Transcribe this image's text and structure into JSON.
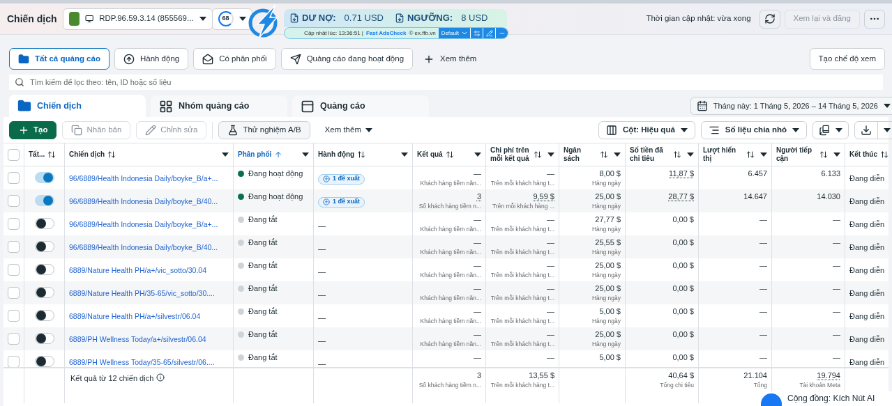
{
  "header": {
    "title": "Chiến dịch",
    "account": "RDP.96.59.3.14 (855569...",
    "score": "68",
    "update_time": "Thời gian cập nhật: vừa xong",
    "review_button": {
      "label": "Xem lại và đăng",
      "disabled": true
    }
  },
  "extension": {
    "debt_label": "DƯ NỢ:",
    "debt_value": "0.71 USD",
    "threshold_label": "NGƯỠNG:",
    "threshold_value": "8 USD",
    "updated": "Cập nhật lúc: 13:36:51 |",
    "brand": "Fast AdsCheck",
    "site": "© ex.ffb.vn",
    "preset": "Default"
  },
  "filters": [
    {
      "label": "Tất cả quảng cáo",
      "selected": true,
      "kind": "folder"
    },
    {
      "label": "Hành động",
      "selected": false,
      "kind": "action"
    },
    {
      "label": "Có phân phối",
      "selected": false,
      "kind": "mail"
    },
    {
      "label": "Quảng cáo đang hoạt động",
      "selected": false,
      "kind": "send"
    },
    {
      "label": "Xem thêm",
      "selected": false,
      "kind": "more"
    }
  ],
  "create_view": "Tạo chế độ xem",
  "search": {
    "placeholder": "Tìm kiếm để lọc theo: tên, ID hoặc số liệu"
  },
  "levels": [
    {
      "label": "Chiến dịch",
      "selected": true,
      "kind": "campaign"
    },
    {
      "label": "Nhóm quảng cáo",
      "selected": false,
      "kind": "adset"
    },
    {
      "label": "Quảng cáo",
      "selected": false,
      "kind": "ad"
    }
  ],
  "date_range": "Tháng này: 1 Tháng 5, 2026 – 14 Tháng 5, 2026",
  "toolbar": [
    {
      "label": "Tạo",
      "kind": "create",
      "disabled": false
    },
    {
      "label": "Nhân bản",
      "kind": "duplicate",
      "disabled": true
    },
    {
      "label": "Chỉnh sửa",
      "kind": "edit",
      "disabled": true
    },
    {
      "label": "Thử nghiệm A/B",
      "kind": "test",
      "disabled": false
    },
    {
      "label": "Xem thêm",
      "kind": "more",
      "disabled": false
    }
  ],
  "toolbar_right": [
    {
      "label": "Cột: Hiệu quả",
      "kind": "columns"
    },
    {
      "label": "Số liệu chia nhỏ",
      "kind": "breakdown"
    }
  ],
  "select_all": {
    "checked": false
  },
  "columns": [
    {
      "label": "Tất...",
      "sorted": false
    },
    {
      "label": "Chiến dịch",
      "sorted": false
    },
    {
      "label": "Phân phối",
      "sorted": true
    },
    {
      "label": "Hành động",
      "sorted": false
    },
    {
      "label": "Kết quả",
      "sorted": false
    },
    {
      "label": "Chi phí trên mỗi kết quả",
      "sorted": false
    },
    {
      "label": "Ngân sách",
      "sorted": false
    },
    {
      "label": "Số tiền đã chi tiêu",
      "sorted": false
    },
    {
      "label": "Lượt hiển thị",
      "sorted": false
    },
    {
      "label": "Người tiếp cận",
      "sorted": false
    },
    {
      "label": "Kết thúc",
      "sorted": false
    }
  ],
  "rows": [
    {
      "checked": false,
      "on": true,
      "name": "96/6889/Health Indonesia Daily/boyke_B/a+...",
      "delivery": {
        "text": "Đang hoạt động",
        "active": true
      },
      "action": "1 đề xuất",
      "result": {
        "value": "—",
        "sub": "Khách hàng tiềm năn...",
        "linked": false
      },
      "cost": {
        "value": "—",
        "sub": "Trên mỗi khách hàng t...",
        "linked": false
      },
      "budget": {
        "value": "8,00 $",
        "sub": "Hàng ngày"
      },
      "spent": {
        "value": "11,87 $",
        "linked": true
      },
      "impressions": "6.457",
      "reach": "6.133",
      "end": "Đang diễn"
    },
    {
      "checked": false,
      "on": true,
      "name": "96/6889/Health Indonesia Daily/boyke_B/40...",
      "delivery": {
        "text": "Đang hoạt động",
        "active": true
      },
      "action": "1 đề xuất",
      "result": {
        "value": "3",
        "sub": "Số khách hàng tiềm n...",
        "linked": true
      },
      "cost": {
        "value": "9,59 $",
        "sub": "Trên mỗi khách hàng ...",
        "linked": true
      },
      "budget": {
        "value": "25,00 $",
        "sub": "Hàng ngày"
      },
      "spent": {
        "value": "28,77 $",
        "linked": true
      },
      "impressions": "14.647",
      "reach": "14.030",
      "end": "Đang diễn"
    },
    {
      "checked": false,
      "on": false,
      "name": "96/6889/Health Indonesia Daily/boyke_B/a+...",
      "delivery": {
        "text": "Đang tắt",
        "active": false
      },
      "action": "—",
      "result": {
        "value": "—",
        "sub": "Khách hàng tiềm năn...",
        "linked": false
      },
      "cost": {
        "value": "—",
        "sub": "Trên mỗi khách hàng t...",
        "linked": false
      },
      "budget": {
        "value": "27,77 $",
        "sub": "Hàng ngày"
      },
      "spent": {
        "value": "0,00 $",
        "linked": false
      },
      "impressions": "—",
      "reach": "—",
      "end": "Đang diễn"
    },
    {
      "checked": false,
      "on": false,
      "name": "96/6889/Health Indonesia Daily/boyke_B/40...",
      "delivery": {
        "text": "Đang tắt",
        "active": false
      },
      "action": "—",
      "result": {
        "value": "—",
        "sub": "Khách hàng tiềm năn...",
        "linked": false
      },
      "cost": {
        "value": "—",
        "sub": "Trên mỗi khách hàng t...",
        "linked": false
      },
      "budget": {
        "value": "25,55 $",
        "sub": "Hàng ngày"
      },
      "spent": {
        "value": "0,00 $",
        "linked": false
      },
      "impressions": "—",
      "reach": "—",
      "end": "Đang diễn"
    },
    {
      "checked": false,
      "on": false,
      "name": "6889/Nature Health PH/a+/vic_sotto/30.04",
      "delivery": {
        "text": "Đang tắt",
        "active": false
      },
      "action": "—",
      "result": {
        "value": "—",
        "sub": "Khách hàng tiềm năn...",
        "linked": false
      },
      "cost": {
        "value": "—",
        "sub": "Trên mỗi khách hàng t...",
        "linked": false
      },
      "budget": {
        "value": "25,00 $",
        "sub": "Hàng ngày"
      },
      "spent": {
        "value": "0,00 $",
        "linked": false
      },
      "impressions": "—",
      "reach": "—",
      "end": "Đang diễn"
    },
    {
      "checked": false,
      "on": false,
      "name": "6889/Nature Health PH/35-65/vic_sotto/30....",
      "delivery": {
        "text": "Đang tắt",
        "active": false
      },
      "action": "—",
      "result": {
        "value": "—",
        "sub": "Khách hàng tiềm năn...",
        "linked": false
      },
      "cost": {
        "value": "—",
        "sub": "Trên mỗi khách hàng t...",
        "linked": false
      },
      "budget": {
        "value": "25,00 $",
        "sub": "Hàng ngày"
      },
      "spent": {
        "value": "0,00 $",
        "linked": false
      },
      "impressions": "—",
      "reach": "—",
      "end": "Đang diễn"
    },
    {
      "checked": false,
      "on": false,
      "name": "6889/Nature Health PH/a+/silvestr/06.04",
      "delivery": {
        "text": "Đang tắt",
        "active": false
      },
      "action": "—",
      "result": {
        "value": "—",
        "sub": "Khách hàng tiềm năn...",
        "linked": false
      },
      "cost": {
        "value": "—",
        "sub": "Trên mỗi khách hàng t...",
        "linked": false
      },
      "budget": {
        "value": "5,00 $",
        "sub": "Hàng ngày"
      },
      "spent": {
        "value": "0,00 $",
        "linked": false
      },
      "impressions": "—",
      "reach": "—",
      "end": "Đang diễn"
    },
    {
      "checked": false,
      "on": false,
      "name": "6889/PH Wellness Today/a+/silvestr/06.04",
      "delivery": {
        "text": "Đang tắt",
        "active": false
      },
      "action": "—",
      "result": {
        "value": "—",
        "sub": "Khách hàng tiềm năn...",
        "linked": false
      },
      "cost": {
        "value": "—",
        "sub": "Trên mỗi khách hàng t...",
        "linked": false
      },
      "budget": {
        "value": "25,00 $",
        "sub": "Hàng ngày"
      },
      "spent": {
        "value": "0,00 $",
        "linked": false
      },
      "impressions": "—",
      "reach": "—",
      "end": "Đang diễn"
    },
    {
      "checked": false,
      "on": false,
      "name": "6889/PH Wellness Today/35-65/silvestr/06....",
      "delivery": {
        "text": "Đang tắt",
        "active": false
      },
      "action": "—",
      "result": {
        "value": "—",
        "linked": false
      },
      "cost": {
        "value": "—",
        "linked": false
      },
      "budget": {
        "value": "5,00 $"
      },
      "spent": {
        "value": "0,00 $",
        "linked": false
      },
      "impressions": "—",
      "reach": "—",
      "end": "Đang diễn"
    }
  ],
  "footer": {
    "label": "Kết quả từ 12 chiến dịch",
    "result": {
      "value": "3",
      "sub": "Số khách hàng tiềm n...",
      "linked": false
    },
    "cost": {
      "value": "13,55 $",
      "sub": "Trên mỗi khách hàng t...",
      "linked": false
    },
    "spent": {
      "value": "40,64 $",
      "sub": "Tổng chi tiêu",
      "linked": false
    },
    "impressions": {
      "value": "21.104",
      "sub": "Tổng",
      "linked": false
    },
    "reach": {
      "value": "19.794",
      "sub": "Tài khoản Meta",
      "linked": true
    }
  },
  "community": "Cộng đồng: Kích Nút AI"
}
